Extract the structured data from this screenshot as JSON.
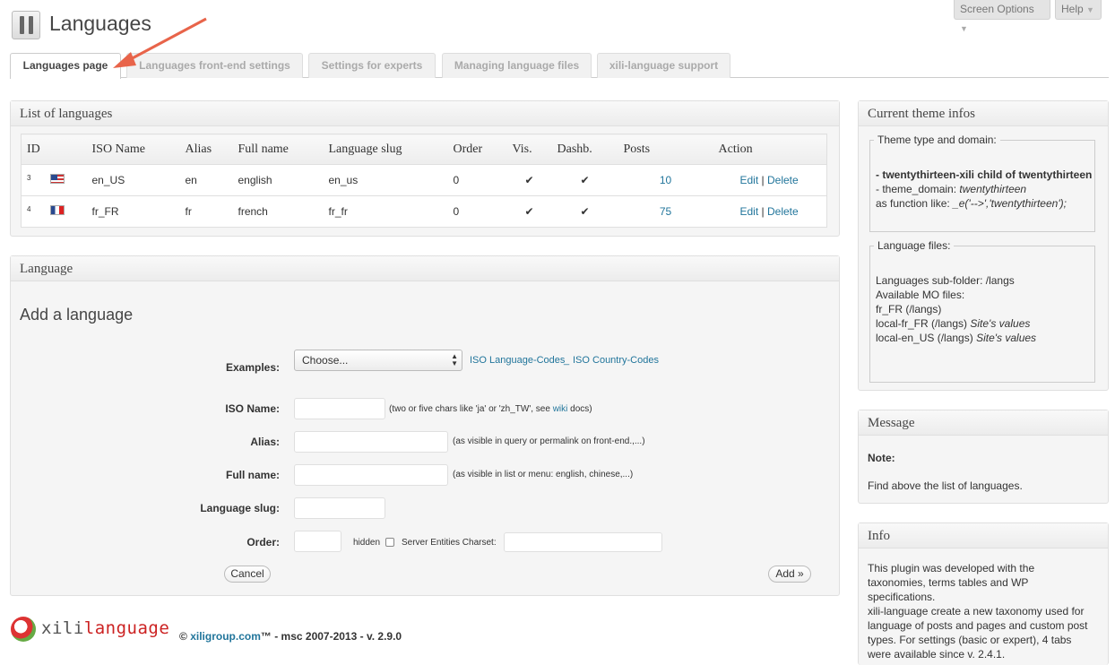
{
  "header": {
    "title": "Languages",
    "screen_options": "Screen Options",
    "help": "Help"
  },
  "tabs": [
    {
      "label": "Languages page"
    },
    {
      "label": "Languages front-end settings"
    },
    {
      "label": "Settings for experts"
    },
    {
      "label": "Managing language files"
    },
    {
      "label": "xili-language support"
    }
  ],
  "list_box": {
    "title": "List of languages",
    "columns": [
      "ID",
      "ISO Name",
      "Alias",
      "Full name",
      "Language slug",
      "Order",
      "Vis.",
      "Dashb.",
      "Posts",
      "Action"
    ],
    "rows": [
      {
        "id": "3",
        "flag": "us-flag",
        "iso": "en_US",
        "alias": "en",
        "full": "english",
        "slug": "en_us",
        "order": "0",
        "vis": "✔",
        "dashb": "✔",
        "posts": "10",
        "edit": "Edit",
        "sep": "|",
        "delete": "Delete"
      },
      {
        "id": "4",
        "flag": "fr-flag",
        "iso": "fr_FR",
        "alias": "fr",
        "full": "french",
        "slug": "fr_fr",
        "order": "0",
        "vis": "✔",
        "dashb": "✔",
        "posts": "75",
        "edit": "Edit",
        "sep": "|",
        "delete": "Delete"
      }
    ]
  },
  "language_box": {
    "title": "Language",
    "subtitle": "Add a language",
    "examples_label": "Examples:",
    "choose": "Choose...",
    "iso_codes_link": "ISO Language-Codes",
    "country_codes_link": "ISO Country-Codes",
    "link_sep": "_",
    "iso_name_label": "ISO Name:",
    "iso_hint_pre": "(two or five chars like 'ja' or 'zh_TW', see",
    "iso_hint_link": "wiki",
    "iso_hint_post": "docs)",
    "alias_label": "Alias:",
    "alias_hint": "(as visible in query or permalink on front-end.,...)",
    "full_label": "Full name:",
    "full_hint": "(as visible in list or menu: english, chinese,...)",
    "slug_label": "Language slug:",
    "order_label": "Order:",
    "hidden_label": "hidden",
    "charset_label": "Server Entities Charset:",
    "cancel": "Cancel",
    "add": "Add »"
  },
  "footer": {
    "logo_a": "xili",
    "logo_b": "language",
    "copy": "©",
    "link": "xiligroup.com",
    "tail": "™ - msc 2007-2013 - v. 2.9.0"
  },
  "theme_box": {
    "title": "Current theme infos",
    "type_legend": "Theme type and domain:",
    "type_line1": "- twentythirteen-xili child of twentythirteen",
    "type_line2_a": "- theme_domain:",
    "type_line2_b": "twentythirteen",
    "type_line3_a": "as function like:",
    "type_line3_b": "_e('-->','twentythirteen');",
    "files_legend": "Language files:",
    "files_line1": "Languages sub-folder: /langs",
    "files_line2": "Available MO files:",
    "files_line3": "fr_FR (/langs)",
    "files_line4_a": "local-fr_FR (/langs)",
    "files_line4_b": "Site's values",
    "files_line5_a": "local-en_US (/langs)",
    "files_line5_b": "Site's values"
  },
  "message_box": {
    "title": "Message",
    "note": "Note:",
    "text": "Find above the list of languages."
  },
  "info_box": {
    "title": "Info",
    "lines": [
      "This plugin was developed with the",
      "taxonomies, terms tables and WP",
      "specifications.",
      "xili-language create a new taxonomy used for",
      "language of posts and pages and custom post",
      "types. For settings (basic or expert), 4 tabs",
      "were available since v. 2.4.1."
    ]
  }
}
